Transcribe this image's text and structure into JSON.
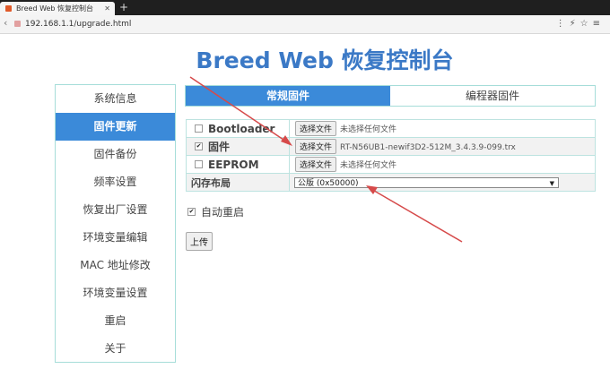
{
  "browser": {
    "tab_title": "Breed Web 恢复控制台",
    "new_tab": "+",
    "url": "192.168.1.1/upgrade.html"
  },
  "heading": "Breed Web 恢复控制台",
  "sidebar": {
    "items": [
      {
        "label": "系统信息"
      },
      {
        "label": "固件更新"
      },
      {
        "label": "固件备份"
      },
      {
        "label": "频率设置"
      },
      {
        "label": "恢复出厂设置"
      },
      {
        "label": "环境变量编辑"
      },
      {
        "label": "MAC 地址修改"
      },
      {
        "label": "环境变量设置"
      },
      {
        "label": "重启"
      },
      {
        "label": "关于"
      }
    ],
    "active_index": 1
  },
  "tabs": [
    {
      "label": "常规固件"
    },
    {
      "label": "编程器固件"
    }
  ],
  "form": {
    "rows": [
      {
        "label": "Bootloader",
        "checked": false,
        "button": "选择文件",
        "file": "未选择任何文件"
      },
      {
        "label": "固件",
        "checked": true,
        "button": "选择文件",
        "file": "RT-N56UB1-newif3D2-512M_3.4.3.9-099.trx"
      },
      {
        "label": "EEPROM",
        "checked": false,
        "button": "选择文件",
        "file": "未选择任何文件"
      }
    ],
    "flash_layout_label": "闪存布局",
    "flash_layout_value": "公版 (0x50000)"
  },
  "auto_reboot": {
    "label": "自动重启",
    "checked": true
  },
  "upload_label": "上传",
  "colors": {
    "accent": "#3b8ad9",
    "heading": "#3b79c6",
    "annotation_arrow": "#d64a4a"
  }
}
